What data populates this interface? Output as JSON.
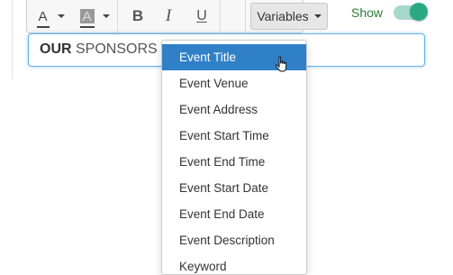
{
  "toolbar": {
    "text_color_icon": "font-color-icon",
    "bg_color_icon": "background-color-icon",
    "bold_icon": "bold-icon",
    "italic_icon": "italic-icon",
    "underline_icon": "underline-icon",
    "text_color_glyph": "A",
    "bg_color_glyph": "A",
    "bold_glyph": "B",
    "italic_glyph": "I",
    "underline_glyph": "U",
    "variables_label": "Variables"
  },
  "visibility": {
    "label": "Show",
    "enabled": true,
    "toggle_color": "#2aaa83"
  },
  "title_field": {
    "bold_text": "OUR",
    "text": " SPONSORS"
  },
  "variables_menu": {
    "highlight_color": "#2f80c6",
    "selected_index": 0,
    "items": [
      "Event Title",
      "Event Venue",
      "Event Address",
      "Event Start Time",
      "Event End Time",
      "Event Start Date",
      "Event End Date",
      "Event Description",
      "Keyword"
    ]
  }
}
